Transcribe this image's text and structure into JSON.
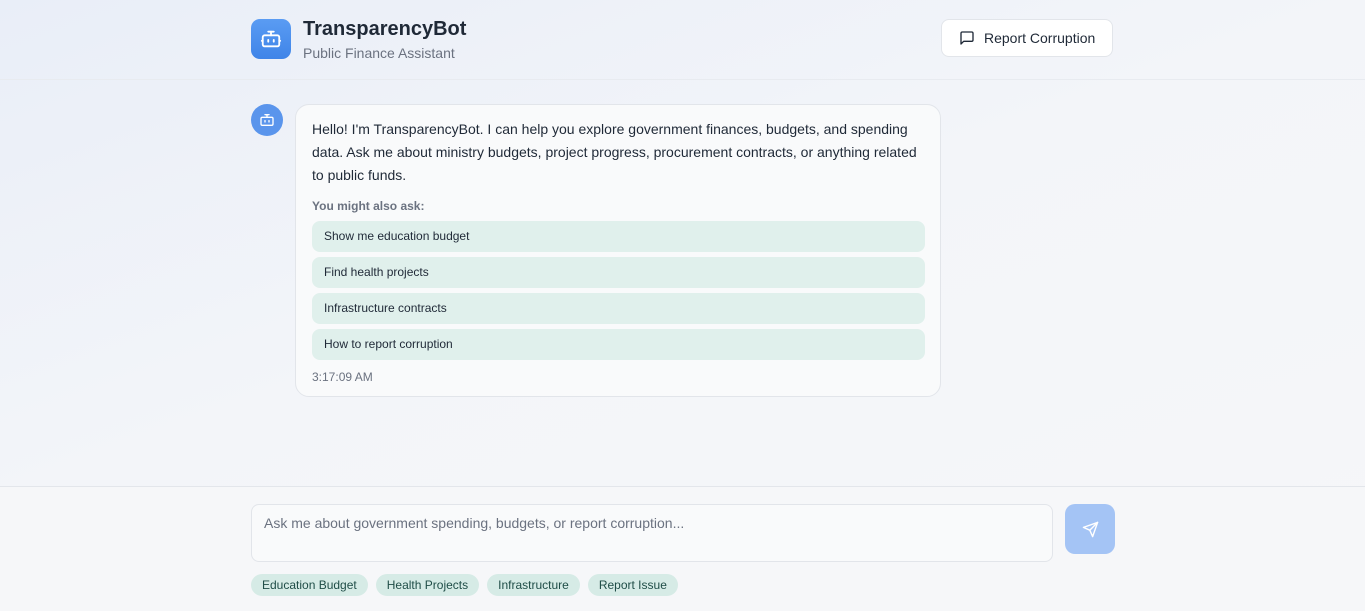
{
  "header": {
    "title": "TransparencyBot",
    "subtitle": "Public Finance Assistant",
    "brand_icon": "robot-icon",
    "report_button": {
      "label": "Report Corruption",
      "icon": "message-square-icon"
    }
  },
  "messages": [
    {
      "sender": "bot",
      "avatar_icon": "robot-icon",
      "text": "Hello! I'm TransparencyBot. I can help you explore government finances, budgets, and spending data. Ask me about ministry budgets, project progress, procurement contracts, or anything related to public funds.",
      "suggestions_heading": "You might also ask:",
      "suggestions": [
        "Show me education budget",
        "Find health projects",
        "Infrastructure contracts",
        "How to report corruption"
      ],
      "timestamp": "3:17:09 AM"
    }
  ],
  "composer": {
    "placeholder": "Ask me about government spending, budgets, or report corruption...",
    "value": "",
    "send_icon": "send-icon",
    "quick_actions": [
      "Education Budget",
      "Health Projects",
      "Infrastructure",
      "Report Issue"
    ]
  },
  "colors": {
    "accent": "#3f84e8",
    "send_disabled": "#a4c4f5",
    "suggestion_bg": "#e0f0ec",
    "chip_bg": "#d6ebe6",
    "chip_text": "#1f4d47"
  }
}
